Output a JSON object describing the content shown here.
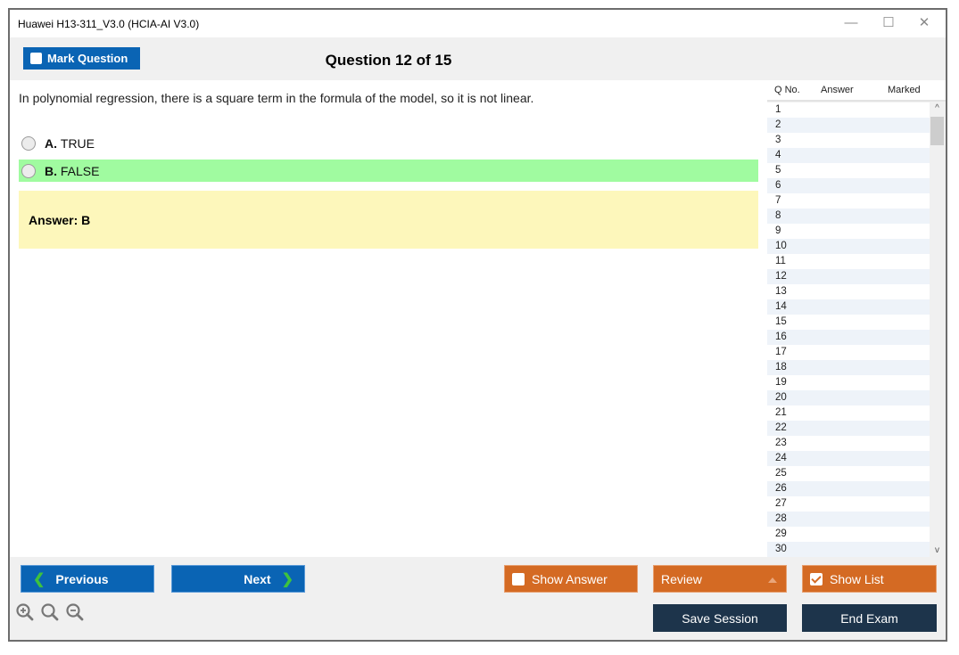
{
  "window": {
    "title": "Huawei H13-311_V3.0 (HCIA-AI V3.0)",
    "controls": {
      "minimize": "—",
      "maximize": "☐",
      "close": "✕"
    }
  },
  "toolbar": {
    "mark_question_label": "Mark Question",
    "question_counter": "Question 12 of 15"
  },
  "question": {
    "text": "In polynomial regression, there is a square term in the formula of the model, so it is not linear.",
    "options": [
      {
        "letter": "A.",
        "text": "TRUE",
        "highlighted": false
      },
      {
        "letter": "B.",
        "text": "FALSE",
        "highlighted": true
      }
    ],
    "answer_text": "Answer: B"
  },
  "question_list": {
    "headers": {
      "qno": "Q No.",
      "answer": "Answer",
      "marked": "Marked"
    },
    "rows": [
      "1",
      "2",
      "3",
      "4",
      "5",
      "6",
      "7",
      "8",
      "9",
      "10",
      "11",
      "12",
      "13",
      "14",
      "15",
      "16",
      "17",
      "18",
      "19",
      "20",
      "21",
      "22",
      "23",
      "24",
      "25",
      "26",
      "27",
      "28",
      "29",
      "30"
    ],
    "scroll_up": "^",
    "scroll_down": "v"
  },
  "footer": {
    "previous_label": "Previous",
    "next_label": "Next",
    "show_answer_label": "Show Answer",
    "show_answer_checked": false,
    "review_label": "Review",
    "show_list_label": "Show List",
    "show_list_checked": true,
    "save_session_label": "Save Session",
    "end_exam_label": "End Exam",
    "zoom_icons": [
      "zoom-in-icon",
      "zoom-reset-icon",
      "zoom-out-icon"
    ]
  },
  "colors": {
    "primary_blue": "#0a64b4",
    "orange": "#d46a23",
    "dark_navy": "#1d344b",
    "correct_green": "#a0fba0",
    "answer_yellow": "#fdf7bb"
  }
}
